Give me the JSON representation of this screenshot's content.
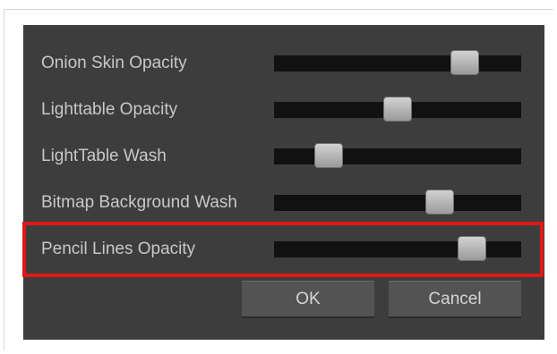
{
  "dialog": {
    "sliders": [
      {
        "label": "Onion Skin Opacity",
        "value": 0.77
      },
      {
        "label": "Lighttable Opacity",
        "value": 0.5
      },
      {
        "label": "LightTable Wash",
        "value": 0.22
      },
      {
        "label": "Bitmap Background Wash",
        "value": 0.67
      },
      {
        "label": "Pencil Lines Opacity",
        "value": 0.8
      }
    ],
    "ok_label": "OK",
    "cancel_label": "Cancel",
    "highlight_color": "#e01818",
    "background_color": "#3d3d3d"
  }
}
